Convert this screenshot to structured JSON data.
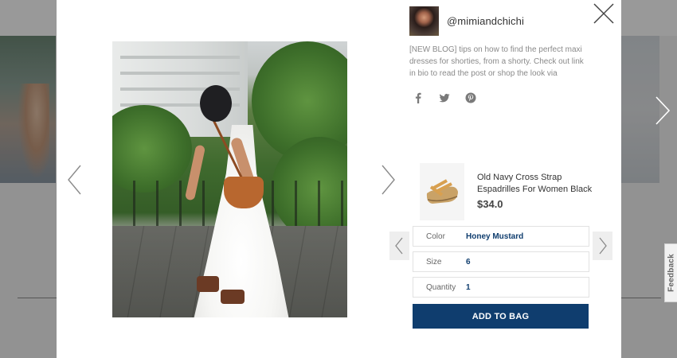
{
  "post": {
    "handle": "@mimiandchichi",
    "caption": "[NEW BLOG] tips on how to find the perfect maxi dresses for shorties, from a shorty. Check out link in bio to read the post or shop the look via",
    "social_icons": [
      "facebook-icon",
      "twitter-icon",
      "pinterest-icon"
    ]
  },
  "product": {
    "name": "Old Navy Cross Strap Espadrilles For Women Black",
    "price": "$34.0",
    "options": [
      {
        "label": "Color",
        "value": "Honey Mustard"
      },
      {
        "label": "Size",
        "value": "6"
      },
      {
        "label": "Quantity",
        "value": "1"
      }
    ],
    "add_to_bag_label": "ADD TO BAG"
  },
  "feedback_label": "Feedback",
  "colors": {
    "accent": "#0f3d6e",
    "caption_text": "#8a8a8a",
    "icon_gray": "#7a7a7a"
  }
}
